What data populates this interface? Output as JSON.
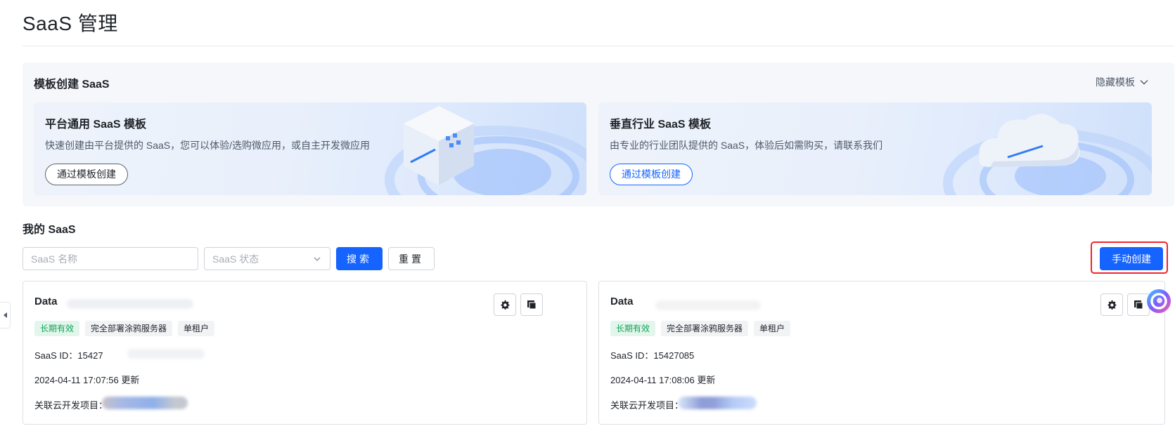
{
  "page": {
    "title": "SaaS 管理"
  },
  "template_panel": {
    "title": "模板创建 SaaS",
    "hide_label": "隐藏模板",
    "cards": [
      {
        "title": "平台通用 SaaS 模板",
        "description": "快速创建由平台提供的 SaaS，您可以体验/选购微应用，或自主开发微应用",
        "button": "通过模板创建"
      },
      {
        "title": "垂直行业 SaaS 模板",
        "description": "由专业的行业团队提供的 SaaS，体验后如需购买，请联系我们",
        "button": "通过模板创建"
      }
    ]
  },
  "my_saas": {
    "title": "我的 SaaS",
    "name_placeholder": "SaaS 名称",
    "status_placeholder": "SaaS 状态",
    "search_label": "搜索",
    "reset_label": "重置",
    "create_label": "手动创建"
  },
  "saas_cards": [
    {
      "name": "Data",
      "tags": [
        "长期有效",
        "完全部署涂鸦服务器",
        "单租户"
      ],
      "id_label": "SaaS ID：",
      "id_value": "15427",
      "updated": "2024-04-11 17:07:56 更新",
      "project_label": "关联云开发项目："
    },
    {
      "name": "Data",
      "tags": [
        "长期有效",
        "完全部署涂鸦服务器",
        "单租户"
      ],
      "id_label": "SaaS ID：",
      "id_value": "15427085",
      "updated": "2024-04-11 17:08:06 更新",
      "project_label": "关联云开发项目："
    }
  ],
  "colors": {
    "primary": "#1664ff",
    "success": "#14a05a",
    "highlight": "#f5222d"
  }
}
